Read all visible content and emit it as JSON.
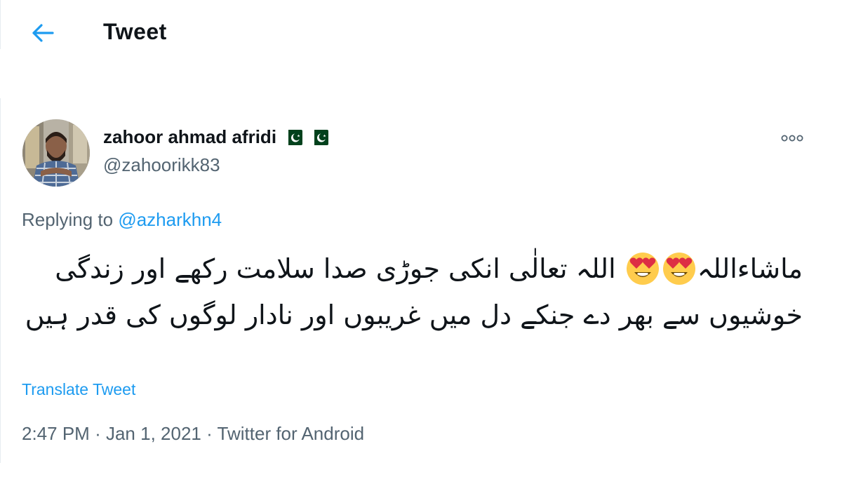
{
  "header": {
    "title": "Tweet",
    "back_icon": "arrow-left-icon"
  },
  "tweet": {
    "author": {
      "name": "zahoor ahmad afridi",
      "handle": "@zahoorikk83",
      "flags": [
        "pakistan-flag-icon",
        "pakistan-flag-icon"
      ]
    },
    "more_icon": "more-options-icon",
    "replying_prefix": "Replying to",
    "replying_to": "@azharkhn4",
    "text_part1": "ماشاءاللہ",
    "text_part2": "اللہ تعالٰی انکی جوڑی صدا سلامت رکھے اور زندگی خوشیوں سے بھر دے جنکے دل میں غریبوں اور نادار لوگوں کی قدر ہیں",
    "emoji": "heart-eyes-emoji",
    "translate_label": "Translate Tweet",
    "time": "2:47 PM",
    "separator": "·",
    "date": "Jan 1, 2021",
    "source": "Twitter for Android"
  },
  "colors": {
    "accent": "#1d9bf0",
    "text_primary": "#0f1419",
    "text_secondary": "#536471",
    "flag_green": "#01411c"
  }
}
